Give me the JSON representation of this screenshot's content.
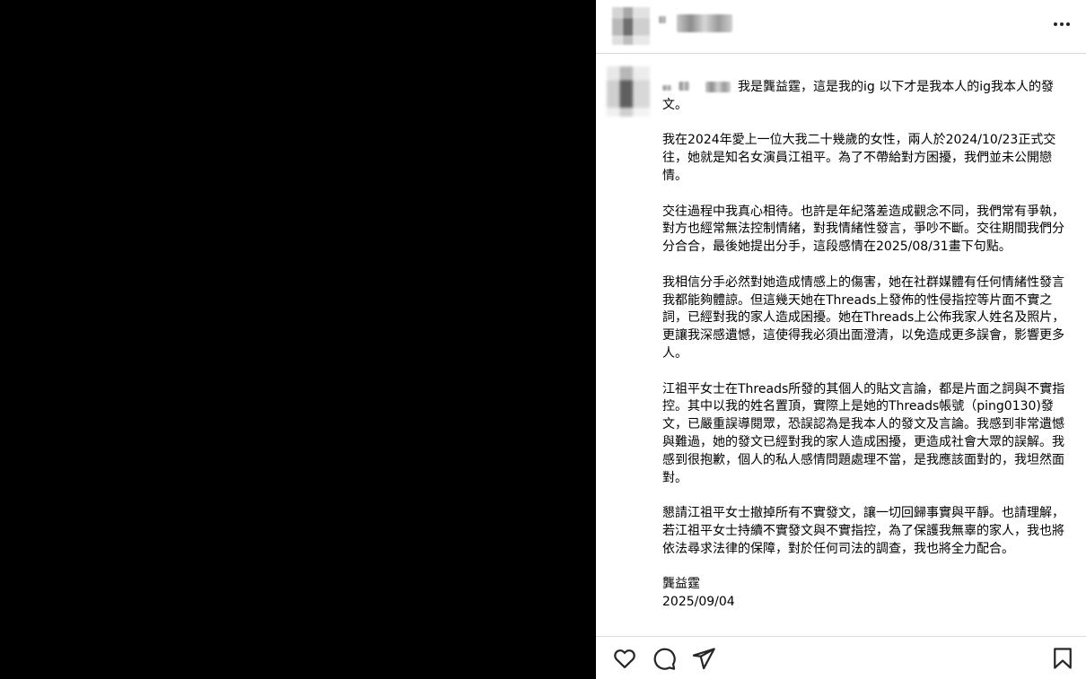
{
  "post": {
    "caption_intro": "我是龔益霆，這是我的ig 以下才是我本人的ig我本人的發文。",
    "paragraphs": [
      "我在2024年愛上一位大我二十幾歲的女性，兩人於2024/10/23正式交往，她就是知名女演員江祖平。為了不帶給對方困擾，我們並未公開戀情。",
      "交往過程中我真心相待。也許是年紀落差造成觀念不同，我們常有爭執，對方也經常無法控制情緒，對我情緒性發言，爭吵不斷。交往期間我們分分合合，最後她提出分手，這段感情在2025/08/31畫下句點。",
      "我相信分手必然對她造成情感上的傷害，她在社群媒體有任何情緒性發言我都能夠體諒。但這幾天她在Threads上發佈的性侵指控等片面不實之詞，已經對我的家人造成困擾。她在Threads上公佈我家人姓名及照片，更讓我深感遺憾，這使得我必須出面澄清，以免造成更多誤會，影響更多人。",
      "江祖平女士在Threads所發的其個人的貼文言論，都是片面之詞與不實指控。其中以我的姓名置頂，實際上是她的Threads帳號（ping0130)發文，已嚴重誤導閱眾，恐誤認為是我本人的發文及言論。我感到非常遺憾與難過，她的發文已經對我的家人造成困擾，更造成社會大眾的誤解。我感到很抱歉，個人的私人感情問題處理不當，是我應該面對的，我坦然面對。",
      "懇請江祖平女士撤掉所有不實發文，讓一切回歸事實與平靜。也請理解，若江祖平女士持續不實發文與不實指控，為了保護我無辜的家人，我也將依法尋求法律的保障，對於任何司法的調查，我也將全力配合。"
    ],
    "signature": "龔益霆",
    "date": "2025/09/04"
  },
  "icons": {
    "more": "more-horizontal-icon",
    "like": "heart-icon",
    "comment": "comment-icon",
    "share": "send-icon",
    "save": "bookmark-icon"
  }
}
